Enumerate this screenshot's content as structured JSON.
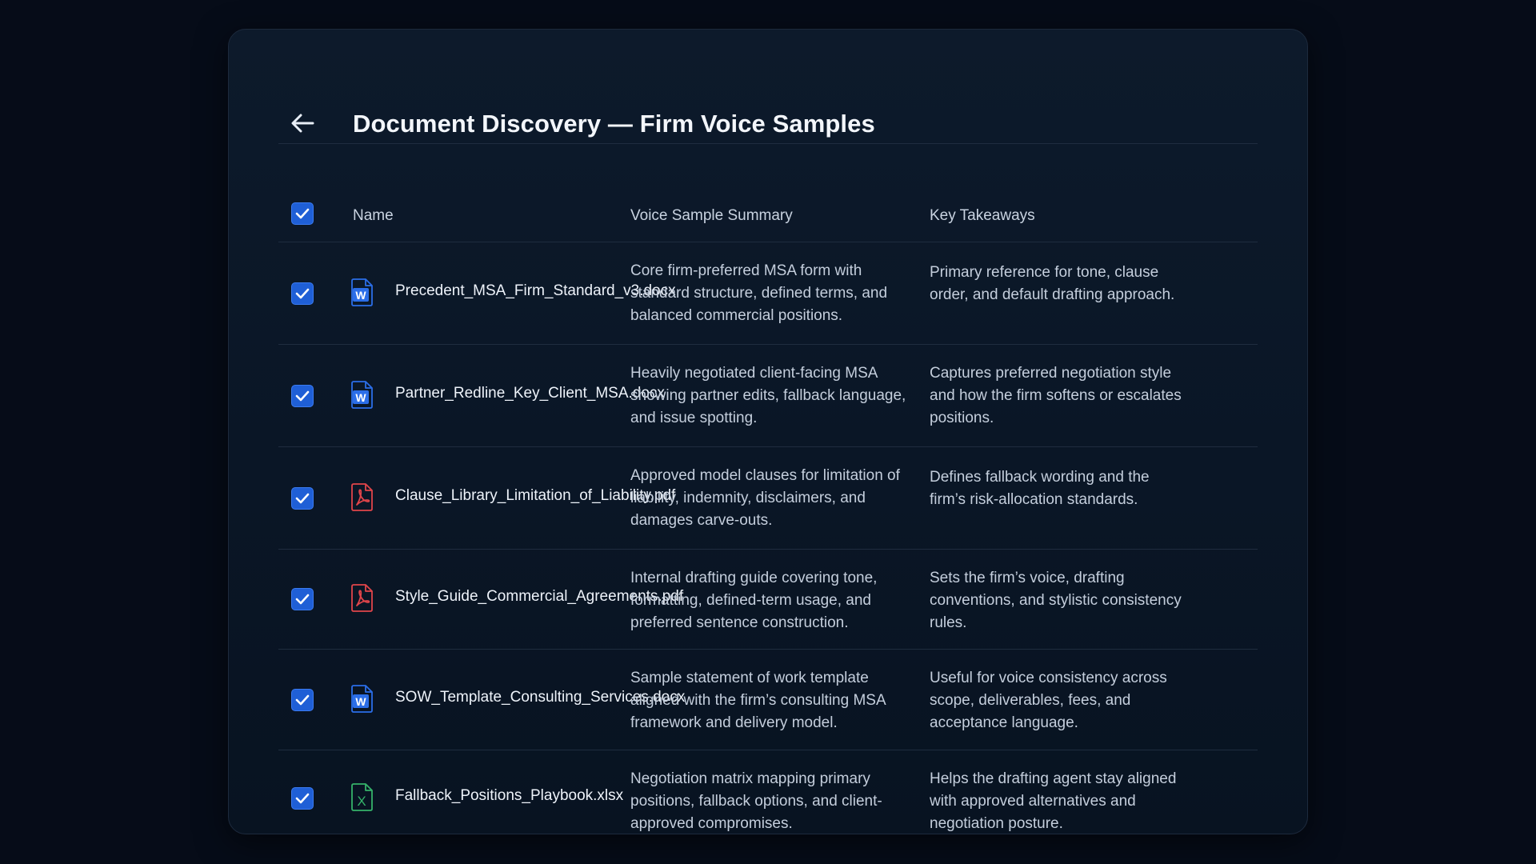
{
  "header": {
    "title": "Document Discovery — Firm Voice Samples",
    "back_icon": "arrow-left-icon"
  },
  "table": {
    "columns": {
      "name": "Name",
      "summary": "Voice Sample Summary",
      "takeaways": "Key Takeaways"
    },
    "select_all_checked": true,
    "rows": [
      {
        "checked": true,
        "icon": "word-doc-icon",
        "name": "Precedent_MSA_Firm_Standard_v3.docx",
        "summary": "Core firm-preferred MSA form with standard structure, defined terms, and balanced commercial positions.",
        "takeaway": "Primary reference for tone, clause order, and default drafting approach."
      },
      {
        "checked": true,
        "icon": "word-doc-icon",
        "name": "Partner_Redline_Key_Client_MSA.docx",
        "summary": "Heavily negotiated client-facing MSA showing partner edits, fallback language, and issue spotting.",
        "takeaway": "Captures preferred negotiation style and how the firm softens or escalates positions."
      },
      {
        "checked": true,
        "icon": "pdf-doc-icon",
        "name": "Clause_Library_Limitation_of_Liability.pdf",
        "summary": "Approved model clauses for limitation of liability, indemnity, disclaimers, and damages carve-outs.",
        "takeaway": "Defines fallback wording and the firm’s risk-allocation standards."
      },
      {
        "checked": true,
        "icon": "pdf-doc-icon",
        "name": "Style_Guide_Commercial_Agreements.pdf",
        "summary": "Internal drafting guide covering tone, formatting, defined-term usage, and preferred sentence construction.",
        "takeaway": "Sets the firm’s voice, drafting conventions, and stylistic consistency rules."
      },
      {
        "checked": true,
        "icon": "word-doc-icon",
        "name": "SOW_Template_Consulting_Services.docx",
        "summary": "Sample statement of work template aligned with the firm’s consulting MSA framework and delivery model.",
        "takeaway": "Useful for voice consistency across scope, deliverables, fees, and acceptance language."
      },
      {
        "checked": true,
        "icon": "excel-doc-icon",
        "name": "Fallback_Positions_Playbook.xlsx",
        "summary": "Negotiation matrix mapping primary positions, fallback options, and client-approved compromises.",
        "takeaway": "Helps the drafting agent stay aligned with approved alternatives and negotiation posture."
      }
    ]
  },
  "colors": {
    "accent": "#1f5fd6",
    "word": "#2b6ee8",
    "pdf": "#e0454a",
    "excel": "#35b26a"
  }
}
